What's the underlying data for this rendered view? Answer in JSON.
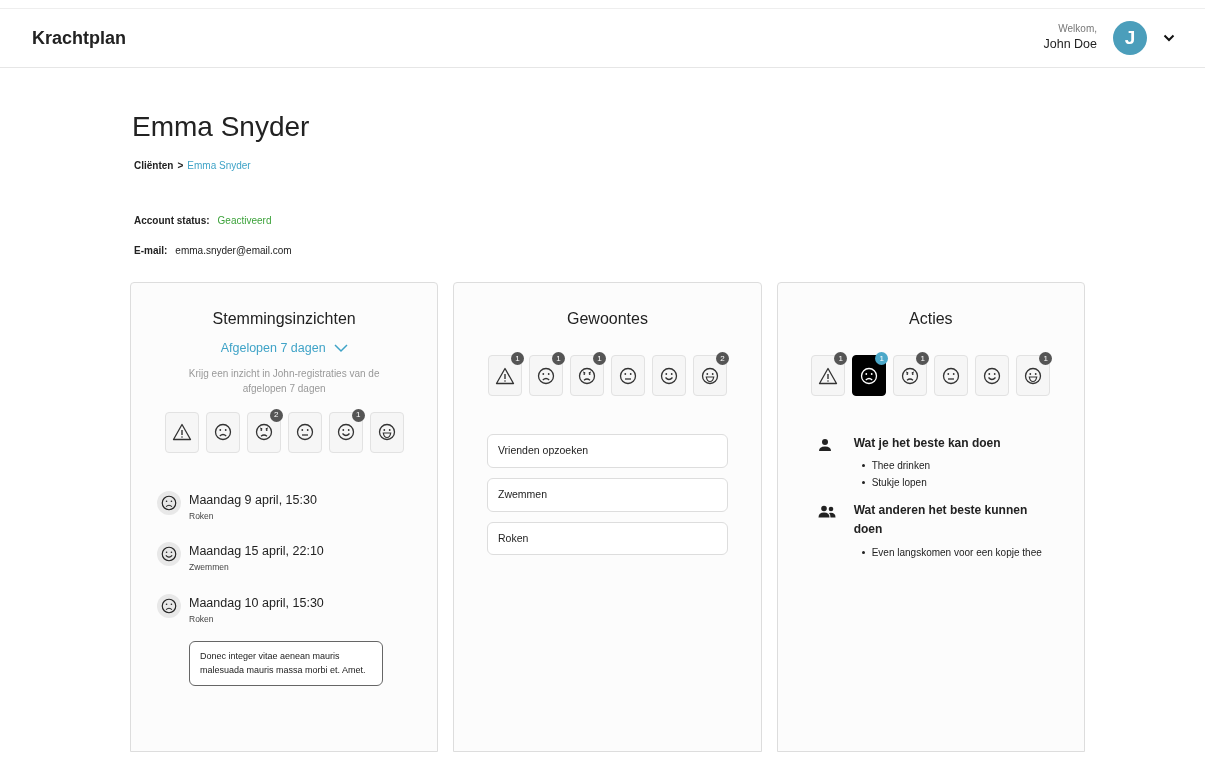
{
  "header": {
    "logo": "Krachtplan",
    "greeting": "Welkom,",
    "user_name": "John Doe",
    "avatar_letter": "J"
  },
  "page": {
    "title": "Emma Snyder",
    "breadcrumb": [
      {
        "label": "Cliënten",
        "current": false
      },
      {
        "label": "Emma Snyder",
        "current": true
      }
    ],
    "breadcrumb_separator": ">"
  },
  "account": [
    {
      "label": "Account status:",
      "value": "Geactiveerd",
      "kind": "status"
    },
    {
      "label": "E-mail:",
      "value": "emma.snyder@email.com",
      "kind": "plain"
    }
  ],
  "mood_panel": {
    "title": "Stemmingsinzichten",
    "period": "Afgelopen 7 dagen",
    "description": "Krijg een inzicht in John-registraties van de afgelopen 7 dagen",
    "moods": [
      {
        "kind": "warning",
        "selected": false
      },
      {
        "kind": "sad",
        "selected": false
      },
      {
        "kind": "unhappy",
        "count": "2",
        "selected": false
      },
      {
        "kind": "neutral",
        "selected": false
      },
      {
        "kind": "happy",
        "count": "1",
        "selected": false
      },
      {
        "kind": "laugh",
        "selected": false
      }
    ],
    "entries": [
      {
        "kind": "sad",
        "title": "Maandag 9 april, 15:30",
        "activity": "Roken"
      },
      {
        "kind": "happy",
        "title": "Maandag 15 april, 22:10",
        "activity": "Zwemmen"
      },
      {
        "kind": "sad",
        "title": "Maandag 10 april, 15:30",
        "activity": "Roken",
        "note": "Donec integer vitae aenean mauris malesuada mauris massa morbi et. Amet."
      }
    ]
  },
  "habits_panel": {
    "title": "Gewoontes",
    "moods": [
      {
        "kind": "warning",
        "count": "1",
        "selected": false
      },
      {
        "kind": "sad",
        "count": "1",
        "selected": false
      },
      {
        "kind": "unhappy",
        "count": "1",
        "selected": false
      },
      {
        "kind": "neutral",
        "selected": false
      },
      {
        "kind": "happy",
        "selected": false
      },
      {
        "kind": "laugh",
        "count": "2",
        "selected": false
      }
    ],
    "habits": [
      "Vrienden opzoeken",
      "Zwemmen",
      "Roken"
    ]
  },
  "actions_panel": {
    "title": "Acties",
    "moods": [
      {
        "kind": "warning",
        "count": "1",
        "selected": false
      },
      {
        "kind": "sad",
        "count": "1",
        "selected": true
      },
      {
        "kind": "unhappy",
        "count": "1",
        "selected": false
      },
      {
        "kind": "neutral",
        "selected": false
      },
      {
        "kind": "happy",
        "selected": false
      },
      {
        "kind": "laugh",
        "count": "1",
        "selected": false
      }
    ],
    "sections": [
      {
        "kind": "self",
        "title": "Wat je het beste kan doen",
        "items": [
          "Thee drinken",
          "Stukje lopen"
        ]
      },
      {
        "kind": "others",
        "title": "Wat anderen het beste kunnen doen",
        "items": [
          "Even langskomen voor een kopje thee"
        ]
      }
    ]
  }
}
